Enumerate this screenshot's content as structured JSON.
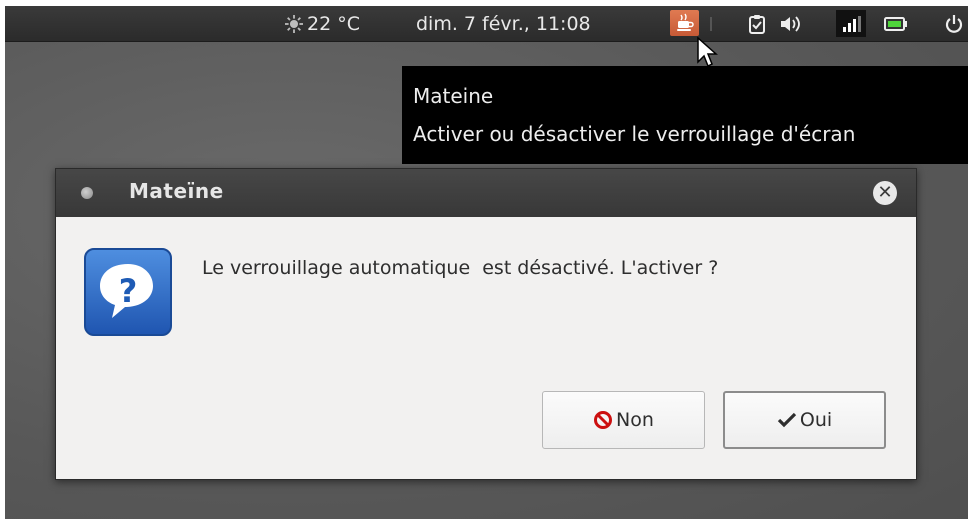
{
  "top_panel": {
    "weather": {
      "icon": "weather-sun-icon",
      "temperature": "22 °C"
    },
    "clock": "dim.  7 févr., 11:08",
    "tray": [
      {
        "icon": "caffeine-cup-icon",
        "active": true
      },
      {
        "icon": "clipboard-icon"
      },
      {
        "icon": "volume-icon"
      },
      {
        "icon": "network-signal-icon"
      },
      {
        "icon": "battery-icon"
      },
      {
        "icon": "power-icon"
      }
    ]
  },
  "tooltip": {
    "title": "Mateine",
    "description": "Activer ou désactiver le verrouillage d'écran"
  },
  "dialog": {
    "title": "Mateïne",
    "icon": "question-icon",
    "message": "Le verrouillage automatique  est désactivé. L'activer ?",
    "buttons": {
      "no_label": "Non",
      "yes_label": "Oui"
    }
  },
  "colors": {
    "panel_bg": "#2f2f2f",
    "caffeine_accent": "#d8683f",
    "dialog_bg": "#f2f1f0",
    "tooltip_bg": "#000000",
    "no_icon_red": "#cc1010"
  }
}
